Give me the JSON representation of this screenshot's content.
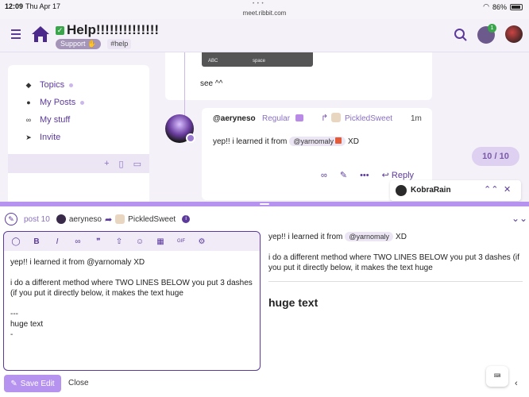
{
  "status": {
    "time": "12:09",
    "date": "Thu Apr 17",
    "url": "meet.ribbit.com",
    "battery": "86%"
  },
  "header": {
    "title": "Help!!!!!!!!!!!!!!",
    "tag_support": "Support ✋",
    "tag_help": "#help",
    "chat_badge": "1"
  },
  "sidebar": {
    "items": [
      {
        "label": "Topics",
        "icon": "layers-icon"
      },
      {
        "label": "My Posts",
        "icon": "user-icon"
      },
      {
        "label": "My stuff",
        "icon": "link-icon"
      },
      {
        "label": "Invite",
        "icon": "send-icon"
      }
    ]
  },
  "prev_post": {
    "kb_key1": "ABC",
    "kb_key2": "space",
    "text": "see ^^"
  },
  "post": {
    "username": "@aeryneso",
    "title": "Regular",
    "reply_to": "PickledSweet",
    "time": "1m",
    "body": "yep!! i learned it from",
    "mention": "@yarnomaly",
    "body_end": "XD",
    "reply_label": "Reply"
  },
  "progress": "10 / 10",
  "chat_pill": {
    "name": "KobraRain"
  },
  "composer": {
    "post_label": "post 10",
    "author": "aeryneso",
    "reply_to": "PickledSweet",
    "editor_text": "yep!! i learned it from @yarnomaly XD\n\ni do a different method where TWO LINES BELOW you put 3 dashes (if you put it directly below, it makes the text huge\n\n---\nhuge text\n-",
    "preview_line1": "yep!! i learned it from",
    "preview_mention": "@yarnomaly",
    "preview_line1_end": "XD",
    "preview_line2": "i do a different method where TWO LINES BELOW you put 3 dashes (if you put it directly below, it makes the text huge",
    "preview_huge": "huge text",
    "save_label": "Save Edit",
    "close_label": "Close"
  },
  "colors": {
    "accent": "#5b3a9b",
    "accent_light": "#b693ee",
    "success": "#3aa54b"
  }
}
